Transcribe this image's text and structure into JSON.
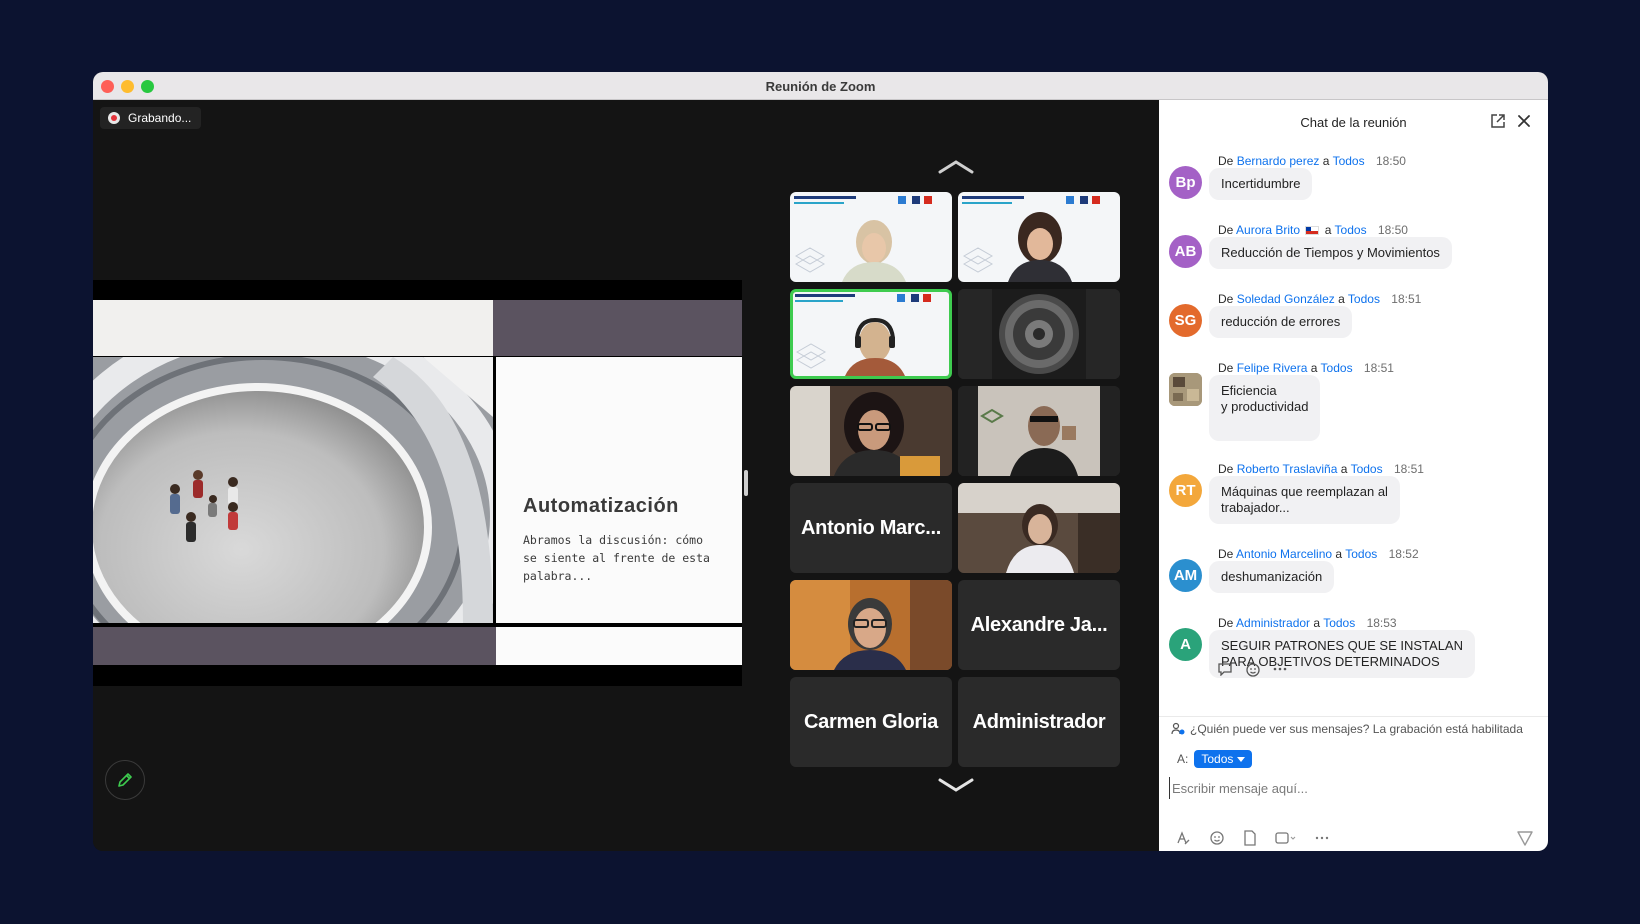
{
  "window": {
    "title": "Reunión de Zoom"
  },
  "recording": {
    "label": "Grabando..."
  },
  "slide": {
    "heading": "Automatización",
    "body": "Abramos la discusión: cómo se siente al frente de esta palabra..."
  },
  "gallery": {
    "named_tiles": [
      "Antonio Marc...",
      "Alexandre Ja...",
      "Carmen Gloria",
      "Administrador"
    ]
  },
  "chat": {
    "title": "Chat de la reunión",
    "from_word": "De",
    "to_word": "a",
    "messages": [
      {
        "initials": "Bp",
        "color": "#a461c6",
        "sender": "Bernardo perez",
        "to": "Todos",
        "time": "18:50",
        "text": "Incertidumbre"
      },
      {
        "initials": "AB",
        "color": "#a461c6",
        "sender": "Aurora Brito",
        "to": "Todos",
        "time": "18:50",
        "text": "Reducción de Tiempos y Movimientos"
      },
      {
        "initials": "SG",
        "color": "#e36a2c",
        "sender": "Soledad González",
        "to": "Todos",
        "time": "18:51",
        "text": "reducción de errores"
      },
      {
        "initials": "",
        "color": "#9a8a6a",
        "sender": "Felipe Rivera",
        "to": "Todos",
        "time": "18:51",
        "text": "Eficiencia\n y productividad"
      },
      {
        "initials": "RT",
        "color": "#f3a73b",
        "sender": "Roberto Traslaviña",
        "to": "Todos",
        "time": "18:51",
        "text": "Máquinas que reemplazan al\ntrabajador..."
      },
      {
        "initials": "AM",
        "color": "#2b8fcf",
        "sender": "Antonio Marcelino",
        "to": "Todos",
        "time": "18:52",
        "text": "deshumanización"
      },
      {
        "initials": "A",
        "color": "#2aa37a",
        "sender": "Administrador",
        "to": "Todos",
        "time": "18:53",
        "text": "SEGUIR PATRONES QUE SE INSTALAN\nPARA OBJETIVOS DETERMINADOS"
      }
    ],
    "notice": "¿Quién puede ver sus mensajes? La grabación está habilitada",
    "to_label": "A:",
    "to_value": "Todos",
    "input_placeholder": "Escribir mensaje aquí..."
  }
}
